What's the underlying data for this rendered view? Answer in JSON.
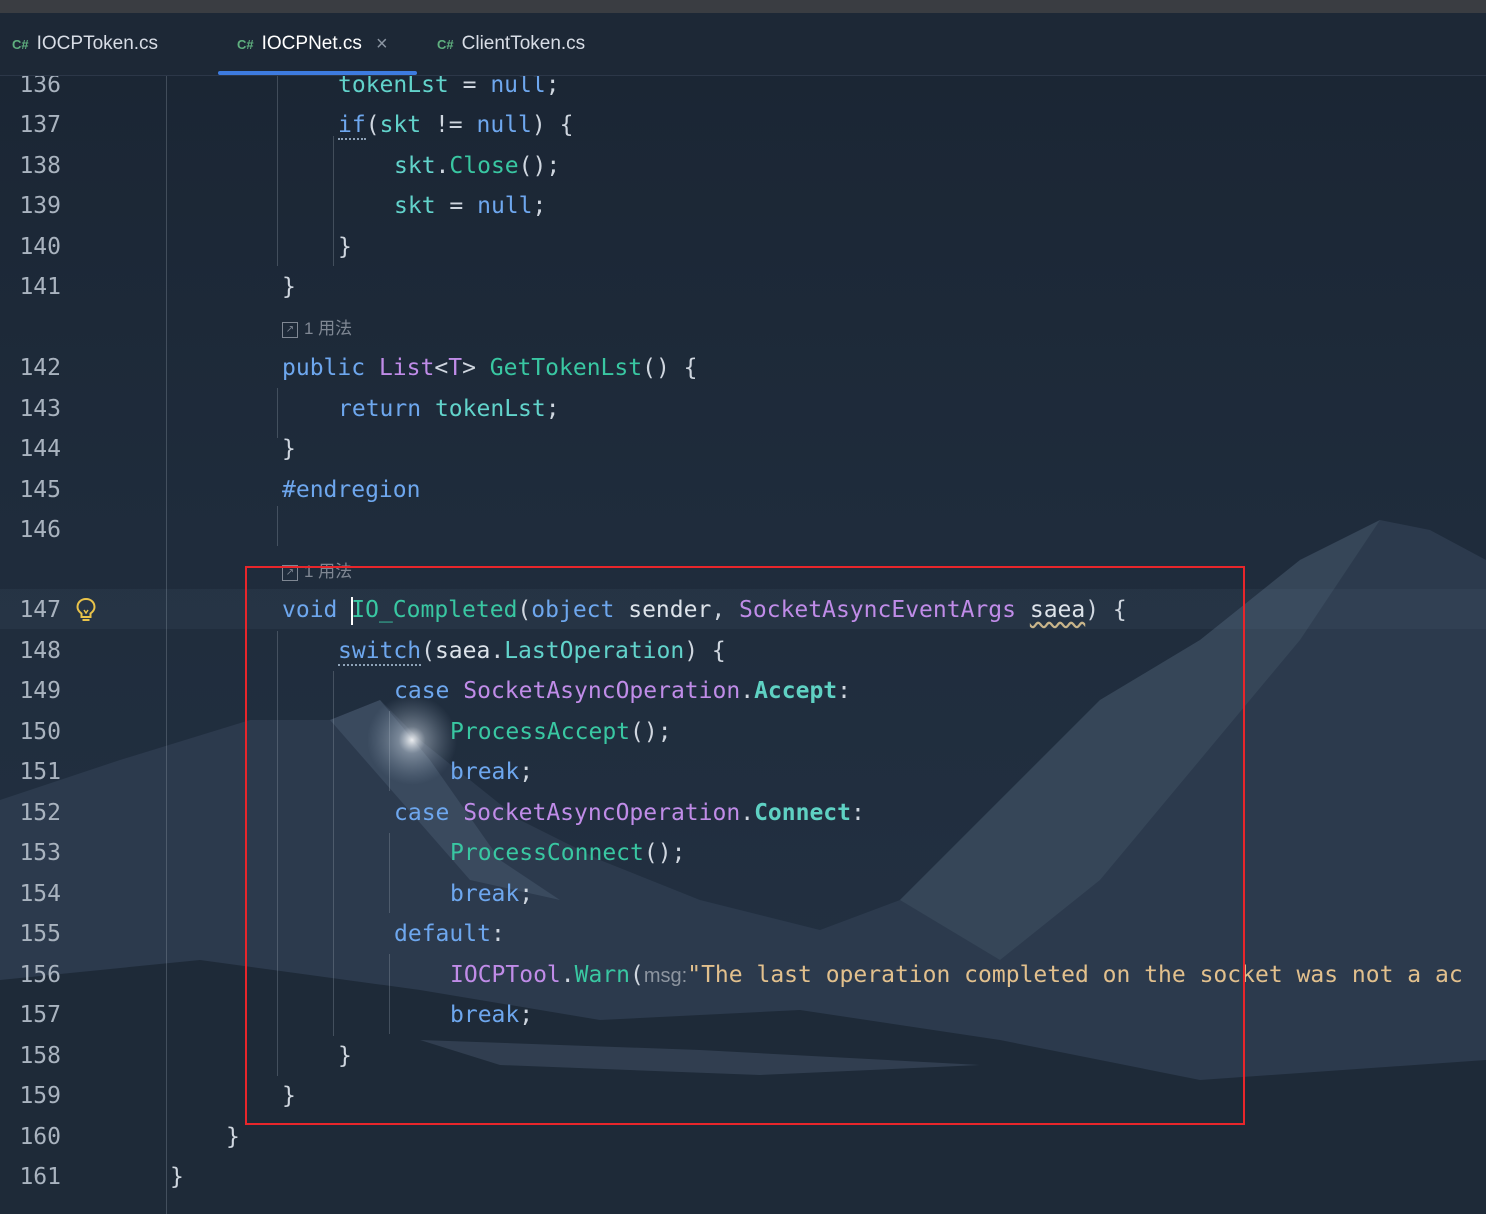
{
  "tabs": [
    {
      "icon": "C#",
      "label": "IOCPToken.cs",
      "active": false
    },
    {
      "icon": "C#",
      "label": "IOCPNet.cs",
      "active": true,
      "close": "×"
    },
    {
      "icon": "C#",
      "label": "ClientToken.cs",
      "active": false
    }
  ],
  "hints": {
    "usage1": "1 用法",
    "usage2": "1 用法"
  },
  "line_numbers": [
    "136",
    "137",
    "138",
    "139",
    "140",
    "141",
    "142",
    "143",
    "144",
    "145",
    "146",
    "147",
    "148",
    "149",
    "150",
    "151",
    "152",
    "153",
    "154",
    "155",
    "156",
    "157",
    "158",
    "159",
    "160",
    "161"
  ],
  "code": {
    "l136": {
      "a": "tokenLst",
      "b": " = ",
      "c": "null",
      "d": ";"
    },
    "l137": {
      "a": "if",
      "b": "(",
      "c": "skt",
      "d": " != ",
      "e": "null",
      "f": ") {"
    },
    "l138": {
      "a": "skt",
      "b": ".",
      "c": "Close",
      "d": "();"
    },
    "l139": {
      "a": "skt",
      "b": " = ",
      "c": "null",
      "d": ";"
    },
    "l140": {
      "a": "}"
    },
    "l141": {
      "a": "}"
    },
    "l142": {
      "a": "public",
      "b": " ",
      "c": "List",
      "d": "<",
      "e": "T",
      "f": "> ",
      "g": "GetTokenLst",
      "h": "() {"
    },
    "l143": {
      "a": "return",
      "b": " ",
      "c": "tokenLst",
      "d": ";"
    },
    "l144": {
      "a": "}"
    },
    "l145": {
      "a": "#endregion"
    },
    "l147": {
      "a": "void",
      "b": " ",
      "c": "IO_Completed",
      "d": "(",
      "e": "object",
      "f": " ",
      "g": "sender",
      "h": ", ",
      "i": "SocketAsyncEventArgs",
      "j": " ",
      "k": "saea",
      "l": ") {"
    },
    "l148": {
      "a": "switch",
      "b": "(",
      "c": "saea",
      "d": ".",
      "e": "LastOperation",
      "f": ") {"
    },
    "l149": {
      "a": "case",
      "b": " ",
      "c": "SocketAsyncOperation",
      "d": ".",
      "e": "Accept",
      "f": ":"
    },
    "l150": {
      "a": "ProcessAccept",
      "b": "();"
    },
    "l151": {
      "a": "break",
      "b": ";"
    },
    "l152": {
      "a": "case",
      "b": " ",
      "c": "SocketAsyncOperation",
      "d": ".",
      "e": "Connect",
      "f": ":"
    },
    "l153": {
      "a": "ProcessConnect",
      "b": "();"
    },
    "l154": {
      "a": "break",
      "b": ";"
    },
    "l155": {
      "a": "default",
      "b": ":"
    },
    "l156": {
      "a": "IOCPTool",
      "b": ".",
      "c": "Warn",
      "d": "(",
      "e": "msg:",
      "f": "\"The last operation completed on the socket was not a ac"
    },
    "l157": {
      "a": "break",
      "b": ";"
    },
    "l158": {
      "a": "}"
    },
    "l159": {
      "a": "}"
    },
    "l160": {
      "a": "}"
    },
    "l161": {
      "a": "}"
    }
  },
  "colors": {
    "keyword": "#6ea7ee",
    "type": "#c08ce8",
    "method": "#39c7a2",
    "string": "#e2c08d",
    "tab_underline": "#3d7be0",
    "highlight_box": "#e8262b"
  }
}
